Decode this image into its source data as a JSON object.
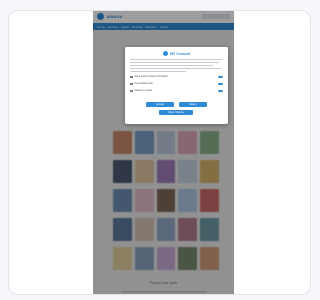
{
  "site": {
    "logo": "MANGA",
    "nav": [
      "Home",
      "Genres",
      "Latest",
      "Popular",
      "Random",
      "Forum"
    ],
    "grid_title": "",
    "grid_caption": "Popular this week",
    "covers": [
      {
        "color": "#c98a6b"
      },
      {
        "color": "#7a9bc4"
      },
      {
        "color": "#b8c7d9"
      },
      {
        "color": "#d9a6b8"
      },
      {
        "color": "#8cb08a"
      },
      {
        "color": "#4d5a73"
      },
      {
        "color": "#e0c3a0"
      },
      {
        "color": "#9e7fb8"
      },
      {
        "color": "#c4d1e0"
      },
      {
        "color": "#d6b36b"
      },
      {
        "color": "#6d8fb3"
      },
      {
        "color": "#e3b9c8"
      },
      {
        "color": "#7d6a5a"
      },
      {
        "color": "#a8c6e0"
      },
      {
        "color": "#c86a6a"
      },
      {
        "color": "#5d7a9c"
      },
      {
        "color": "#d3c2b0"
      },
      {
        "color": "#93a7c7"
      },
      {
        "color": "#b37d8f"
      },
      {
        "color": "#6f9aa3"
      },
      {
        "color": "#e2cf9f"
      },
      {
        "color": "#8aa3c2"
      },
      {
        "color": "#c7a9d6"
      },
      {
        "color": "#7a8a6d"
      },
      {
        "color": "#d09a7a"
      }
    ]
  },
  "consent": {
    "brand": "SFI Consent",
    "options": [
      {
        "label": "Store and/or access information"
      },
      {
        "label": "Personalised ads"
      },
      {
        "label": "Measure content"
      }
    ],
    "buttons": {
      "accept": "Accept",
      "reject": "Reject",
      "settings": "More Options"
    }
  }
}
